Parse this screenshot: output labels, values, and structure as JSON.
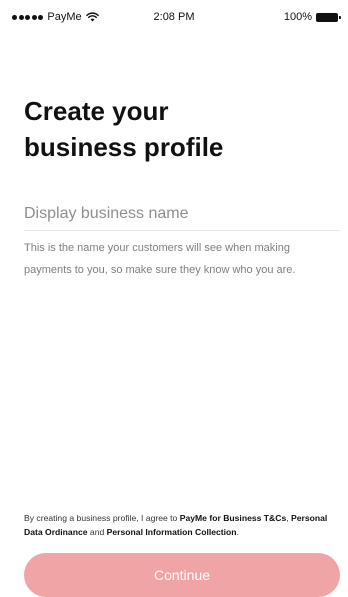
{
  "status_bar": {
    "carrier": "PayMe",
    "time": "2:08 PM",
    "battery": "100%"
  },
  "page": {
    "title": "Create your\nbusiness profile"
  },
  "form": {
    "business_name_placeholder": "Display business name",
    "business_name_value": "",
    "helper_text": "This is the name your customers will see when making payments to you, so make sure they know who you are."
  },
  "agreement": {
    "prefix": "By creating a business profile, I agree to ",
    "terms_link": "PayMe for Business T&Cs",
    "separator": ",",
    "data_link": "Personal Data Ordinance",
    "and": " and ",
    "info_link": "Personal Information Collection",
    "suffix": "."
  },
  "actions": {
    "continue_label": "Continue",
    "continue_color": "#f1a4a6"
  },
  "icons": {
    "signal": "signal-dots-icon",
    "wifi": "wifi-icon",
    "battery": "battery-icon"
  }
}
